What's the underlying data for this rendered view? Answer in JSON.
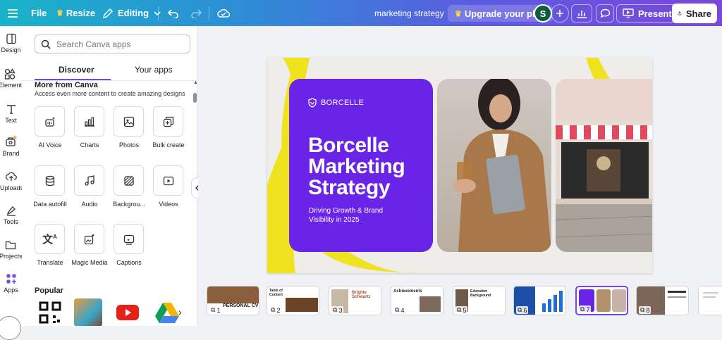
{
  "topbar": {
    "file_label": "File",
    "resize_label": "Resize",
    "editing_label": "Editing",
    "doc_title": "marketing strategy",
    "upgrade_label": "Upgrade your plan",
    "avatar_initial": "S",
    "present_label": "Present",
    "share_label": "Share"
  },
  "rail": [
    {
      "label": "Design",
      "icon": "design-icon"
    },
    {
      "label": "Elements",
      "icon": "elements-icon"
    },
    {
      "label": "Text",
      "icon": "text-icon"
    },
    {
      "label": "Brand",
      "icon": "brand-icon"
    },
    {
      "label": "Uploads",
      "icon": "uploads-icon"
    },
    {
      "label": "Tools",
      "icon": "tools-icon"
    },
    {
      "label": "Projects",
      "icon": "projects-icon"
    },
    {
      "label": "Apps",
      "icon": "apps-icon"
    }
  ],
  "panel": {
    "search_placeholder": "Search Canva apps",
    "tabs": [
      "Discover",
      "Your apps"
    ],
    "section_title": "More from Canva",
    "section_sub": "Access even more content to create amazing designs",
    "apps": [
      {
        "label": "AI Voice",
        "icon": "ai-voice-icon"
      },
      {
        "label": "Charts",
        "icon": "charts-icon"
      },
      {
        "label": "Photos",
        "icon": "photos-icon"
      },
      {
        "label": "Bulk create",
        "icon": "bulk-create-icon"
      },
      {
        "label": "Data autofill",
        "icon": "data-autofill-icon"
      },
      {
        "label": "Audio",
        "icon": "audio-icon"
      },
      {
        "label": "Backgrou...",
        "icon": "backgrounds-icon"
      },
      {
        "label": "Videos",
        "icon": "videos-icon"
      },
      {
        "label": "Translate",
        "icon": "translate-icon"
      },
      {
        "label": "Magic Media",
        "icon": "magic-media-icon"
      },
      {
        "label": "Captions",
        "icon": "captions-icon"
      }
    ],
    "popular_title": "Popular"
  },
  "slide": {
    "brand": "BORCELLE",
    "headline_1": "Borcelle",
    "headline_2": "Marketing",
    "headline_3": "Strategy",
    "subline": "Driving Growth & Brand Visibility in 2025"
  },
  "thumbnails": [
    {
      "num": "1",
      "text": "PERSONAL CV"
    },
    {
      "num": "2",
      "text": "Table of Content"
    },
    {
      "num": "3",
      "text": "Brigitte Schwartz"
    },
    {
      "num": "4",
      "text": "Achievements"
    },
    {
      "num": "5",
      "text": "Education Background"
    },
    {
      "num": "6",
      "text": ""
    },
    {
      "num": "7",
      "text": ""
    },
    {
      "num": "8",
      "text": ""
    },
    {
      "num": "",
      "text": ""
    }
  ],
  "colors": {
    "accent": "#7a46dc",
    "slide_purple": "#6a24e8",
    "slide_yellow": "#efe320"
  }
}
